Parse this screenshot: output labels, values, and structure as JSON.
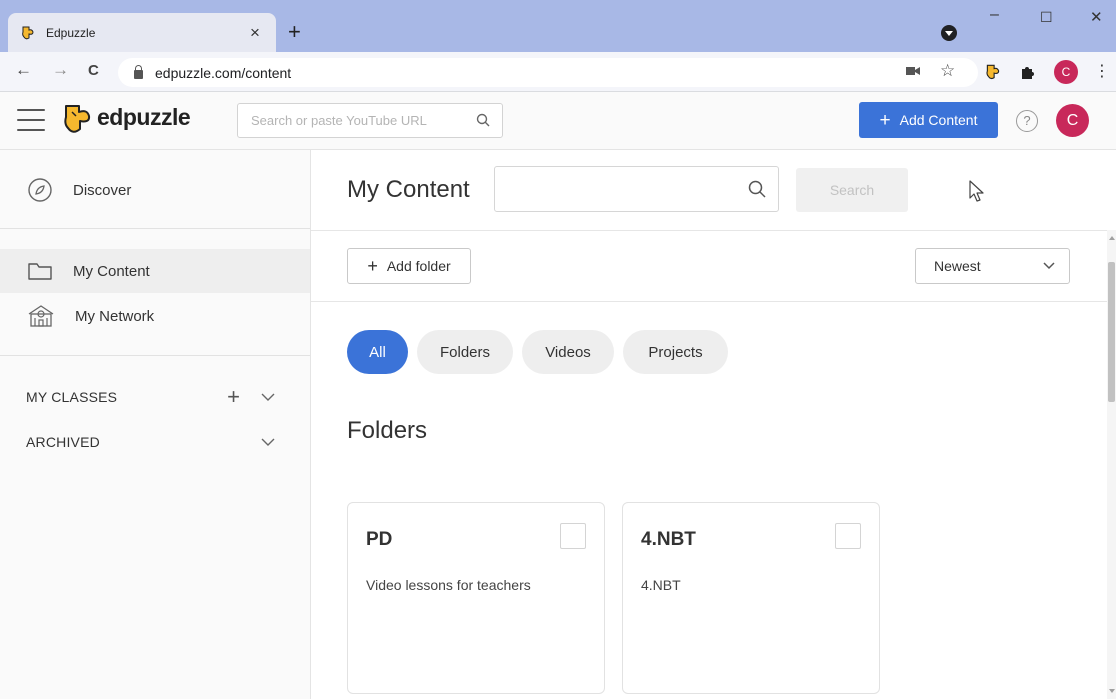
{
  "browser": {
    "tab_title": "Edpuzzle",
    "tab_close": "×",
    "new_tab": "+",
    "url": "edpuzzle.com/content",
    "back": "←",
    "forward": "→",
    "reload": "C",
    "profile_initial": "C",
    "menu": "⋮",
    "minimize": "–",
    "maximize": "☐",
    "close": "✕"
  },
  "header": {
    "logo_text": "edpuzzle",
    "search_placeholder": "Search or paste YouTube URL",
    "add_content_label": "Add Content",
    "help_label": "?",
    "avatar_initial": "C"
  },
  "sidebar": {
    "discover": "Discover",
    "my_content": "My Content",
    "my_network": "My Network",
    "my_classes": "MY CLASSES",
    "archived": "ARCHIVED"
  },
  "main": {
    "title": "My Content",
    "search_placeholder": "",
    "search_button": "Search",
    "add_folder_label": "Add folder",
    "sort_value": "Newest",
    "filters": [
      "All",
      "Folders",
      "Videos",
      "Projects"
    ],
    "active_filter": "All",
    "folders_heading": "Folders",
    "folders": [
      {
        "name": "PD",
        "description": "Video lessons for teachers"
      },
      {
        "name": "4.NBT",
        "description": "4.NBT"
      }
    ]
  },
  "colors": {
    "accent": "#3b73d8",
    "avatar": "#c8285a",
    "logo": "#f5b82e",
    "tabstrip": "#a8b8e6"
  }
}
